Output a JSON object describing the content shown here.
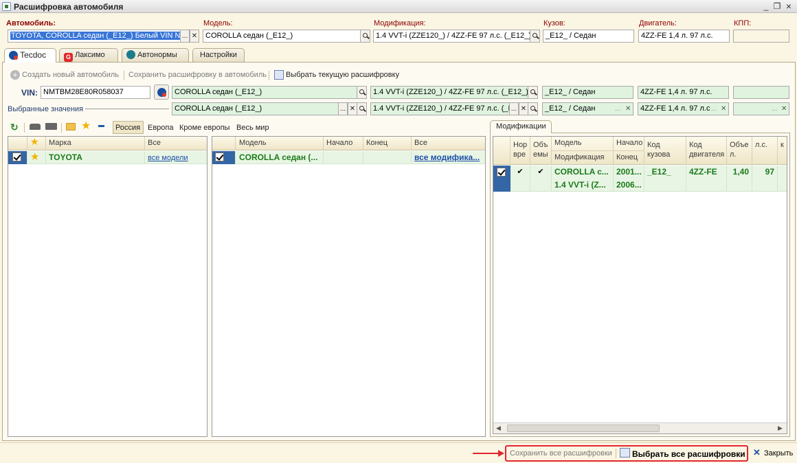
{
  "window": {
    "title": "Расшифровка автомобиля",
    "controls": {
      "minimize": "_",
      "restore": "❐",
      "close": "×"
    }
  },
  "header": {
    "car_label": "Автомобиль:",
    "car_value": "TOYOTA, COROLLA седан (_E12_) Белый VIN NM",
    "model_label": "Модель:",
    "model_value": "COROLLA седан (_E12_)",
    "mod_label": "Модификация:",
    "mod_value": "1.4 VVT-i (ZZE120_) / 4ZZ-FE 97 л.с. (_E12_)",
    "body_label": "Кузов:",
    "body_value": "_E12_ / Седан",
    "engine_label": "Двигатель:",
    "engine_value": "4ZZ-FE 1,4 л. 97 л.с.",
    "kpp_label": "КПП:",
    "kpp_value": ""
  },
  "tabs": [
    {
      "label": "Tecdoc",
      "active": true
    },
    {
      "label": "Лаксимо",
      "active": false
    },
    {
      "label": "Автонормы",
      "active": false
    },
    {
      "label": "Настройки",
      "active": false
    }
  ],
  "toolbar": {
    "create_new": "Создать новый автомобиль",
    "save_decode": "Сохранить расшифровку в автомобиль",
    "select_current": "Выбрать текущую расшифровку"
  },
  "vin_row": {
    "label": "VIN:",
    "value": "NMTBM28E80R058037",
    "model": "COROLLA седан (_E12_)",
    "mod": "1.4 VVT-i (ZZE120_) / 4ZZ-FE 97 л.с. (_E12_)",
    "body": "_E12_ / Седан",
    "engine": "4ZZ-FE 1,4 л. 97 л.с.",
    "kpp": ""
  },
  "selected_row": {
    "label": "Выбранные значения",
    "model": "COROLLA седан (_E12_)",
    "mod": "1.4 VVT-i (ZZE120_) / 4ZZ-FE 97 л.с. (_E",
    "body": "_E12_ / Седан",
    "engine": "4ZZ-FE 1,4 л. 97 л.с",
    "kpp": ""
  },
  "filters": [
    "Россия",
    "Европа",
    "Кроме европы",
    "Весь мир"
  ],
  "brand_grid": {
    "headers": {
      "brand": "Марка",
      "all": "Все"
    },
    "rows": [
      {
        "brand": "TOYOTA",
        "all": "все модели"
      }
    ]
  },
  "model_grid": {
    "headers": {
      "model": "Модель",
      "start": "Начало",
      "end": "Конец",
      "all": "Все"
    },
    "rows": [
      {
        "model": "COROLLA седан (...",
        "start": "",
        "end": "",
        "all": "все модифика..."
      }
    ]
  },
  "mod_panel": {
    "tab_label": "Модификации",
    "headers": {
      "norm1": "Нор",
      "norm2": "вре",
      "vol1": "Объ",
      "vol2": "емы",
      "model": "Модель",
      "modif": "Модификация",
      "start": "Начало",
      "end": "Конец",
      "body1": "Код",
      "body2": "кузова",
      "eng1": "Код",
      "eng2": "двигателя",
      "volume1": "Объе",
      "volume2": "л.",
      "hp": "л.с.",
      "k": "к"
    },
    "row": {
      "norm": "✔",
      "vol": "✔",
      "model": "COROLLA с...",
      "modif": "1.4 VVT-i (Z...",
      "start": "2001...",
      "end": "2006...",
      "body": "_E12_",
      "engine": "4ZZ-FE",
      "volume": "1,40",
      "hp": "97"
    }
  },
  "bottom": {
    "save_all": "Сохранить все расшифровки",
    "select_all": "Выбрать все расшифровки",
    "close": "Закрыть"
  },
  "colors": {
    "accent_red": "#e2262f",
    "green_row": "#e8f5e4",
    "link": "#1d4fa8"
  }
}
